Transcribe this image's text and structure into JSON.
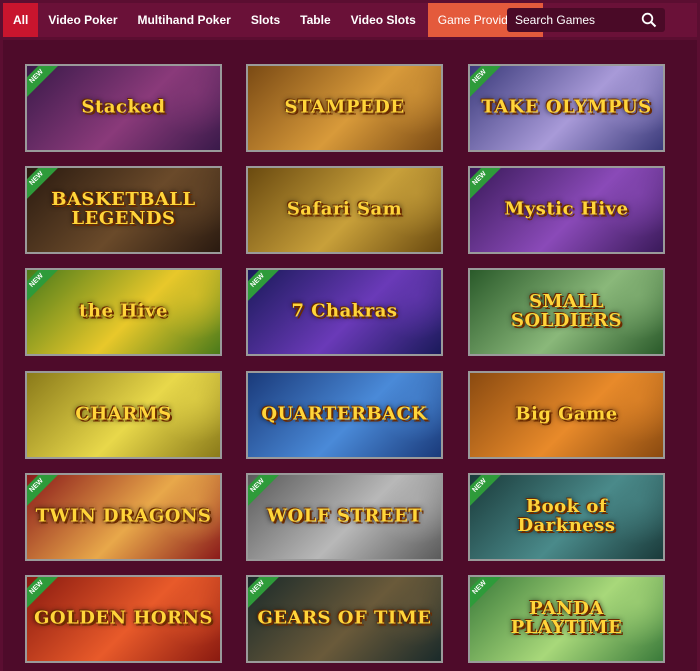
{
  "nav": {
    "items": [
      {
        "label": "All"
      },
      {
        "label": "Video Poker"
      },
      {
        "label": "Multihand Poker"
      },
      {
        "label": "Slots"
      },
      {
        "label": "Table"
      },
      {
        "label": "Video Slots"
      }
    ],
    "provider_label": "Game Provider",
    "search_placeholder": "Search Games"
  },
  "games": [
    {
      "title": "Stacked",
      "new": true,
      "bg": "#3a1a4a",
      "bg2": "#8a3a7a",
      "badge": "NEW"
    },
    {
      "title": "STAMPEDE",
      "new": false,
      "bg": "#7a4a14",
      "bg2": "#d89a3a",
      "badge": ""
    },
    {
      "title": "TAKE OLYMPUS",
      "new": true,
      "bg": "#3a3a7a",
      "bg2": "#a89ad8",
      "badge": "NEW"
    },
    {
      "title": "BASKETBALL LEGENDS",
      "new": true,
      "bg": "#2a1a10",
      "bg2": "#6a4a2a",
      "badge": "NEW"
    },
    {
      "title": "Safari Sam",
      "new": false,
      "bg": "#6a4a10",
      "bg2": "#c8a03a",
      "badge": ""
    },
    {
      "title": "Mystic Hive",
      "new": true,
      "bg": "#3a1a5a",
      "bg2": "#8a4ab8",
      "badge": "NEW"
    },
    {
      "title": "the Hive",
      "new": true,
      "bg": "#4a7a1a",
      "bg2": "#e8c82a",
      "badge": "NEW"
    },
    {
      "title": "7 Chakras",
      "new": true,
      "bg": "#1a1a5a",
      "bg2": "#6a3ab8",
      "badge": "NEW"
    },
    {
      "title": "SMALL SOLDIERS",
      "new": false,
      "bg": "#2a5a2a",
      "bg2": "#8ab87a",
      "badge": ""
    },
    {
      "title": "CHARMS",
      "new": false,
      "bg": "#8a7a1a",
      "bg2": "#e8d84a",
      "badge": ""
    },
    {
      "title": "QUARTERBACK",
      "new": false,
      "bg": "#1a3a7a",
      "bg2": "#4a8ad8",
      "badge": ""
    },
    {
      "title": "Big Game",
      "new": false,
      "bg": "#8a4a10",
      "bg2": "#e88a2a",
      "badge": ""
    },
    {
      "title": "TWIN DRAGONS",
      "new": true,
      "bg": "#8a1a1a",
      "bg2": "#e8a84a",
      "badge": "NEW"
    },
    {
      "title": "WOLF STREET",
      "new": true,
      "bg": "#5a5a5a",
      "bg2": "#b8b8b8",
      "badge": "NEW"
    },
    {
      "title": "Book of Darkness",
      "new": true,
      "bg": "#1a3a3a",
      "bg2": "#4a8a8a",
      "badge": "NEW"
    },
    {
      "title": "GOLDEN HORNS",
      "new": true,
      "bg": "#8a1a10",
      "bg2": "#e85a2a",
      "badge": "NEW"
    },
    {
      "title": "GEARS OF TIME",
      "new": true,
      "bg": "#1a2a2a",
      "bg2": "#6a5a3a",
      "badge": "NEW"
    },
    {
      "title": "PANDA PLAYTIME",
      "new": true,
      "bg": "#3a7a3a",
      "bg2": "#a8d87a",
      "badge": "NEW"
    }
  ]
}
